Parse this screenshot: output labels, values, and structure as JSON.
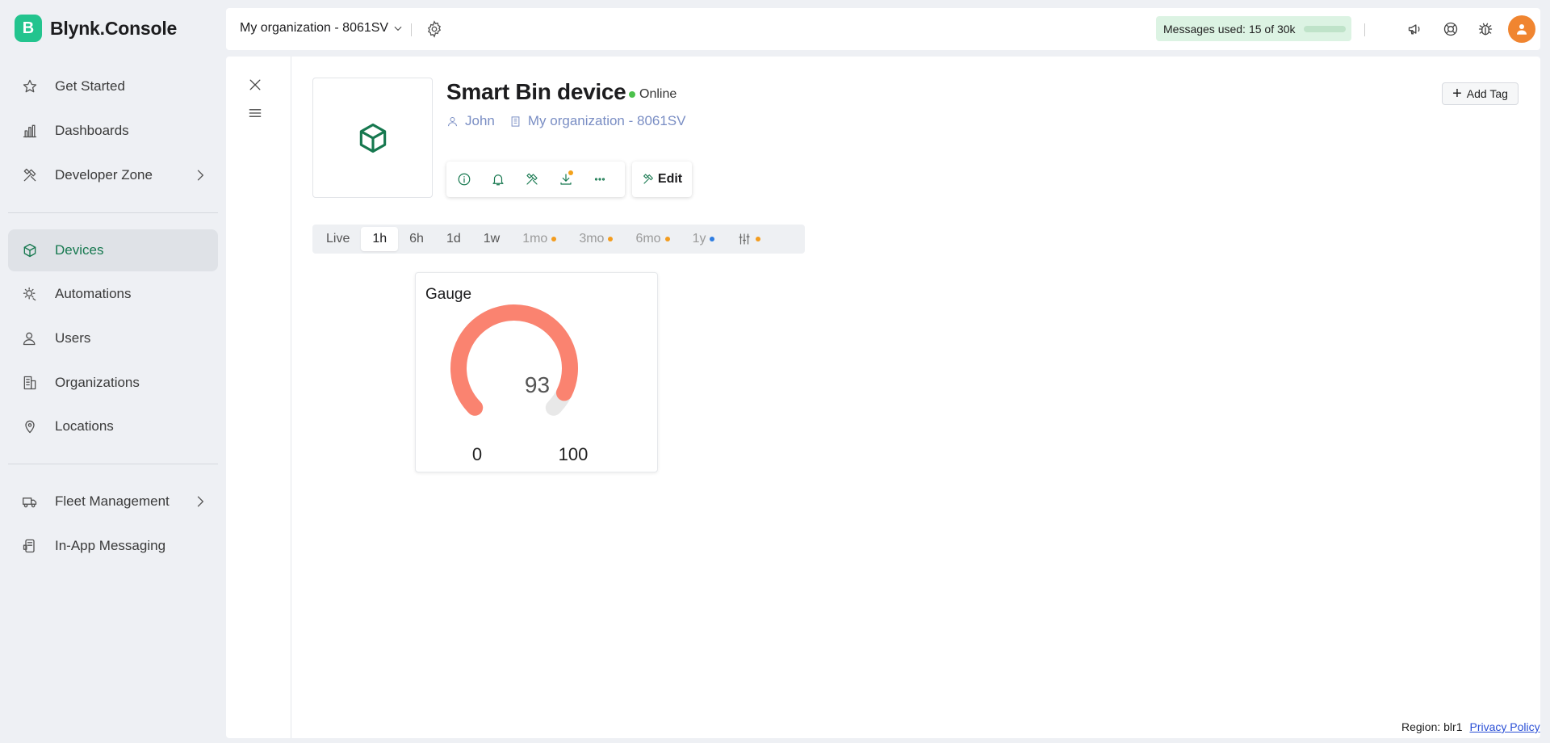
{
  "brand": {
    "badge": "B",
    "name": "Blynk.Console"
  },
  "sidebar": {
    "items": [
      {
        "label": "Get Started",
        "icon": "star-icon"
      },
      {
        "label": "Dashboards",
        "icon": "bar-chart-icon"
      },
      {
        "label": "Developer Zone",
        "icon": "tools-icon",
        "has_chevron": true
      },
      {
        "label": "Devices",
        "icon": "cube-icon",
        "active": true
      },
      {
        "label": "Automations",
        "icon": "automation-icon"
      },
      {
        "label": "Users",
        "icon": "user-icon"
      },
      {
        "label": "Organizations",
        "icon": "building-icon"
      },
      {
        "label": "Locations",
        "icon": "location-pin-icon"
      },
      {
        "label": "Fleet Management",
        "icon": "truck-icon",
        "has_chevron": true
      },
      {
        "label": "In-App Messaging",
        "icon": "message-icon"
      }
    ]
  },
  "header": {
    "org_select": "My organization - 8061SV",
    "messages_label": "Messages used:",
    "messages_value": "15 of 30k",
    "messages_fraction": 0.0005,
    "icons": [
      "megaphone-icon",
      "help-lifebuoy-icon",
      "bug-icon",
      "avatar"
    ]
  },
  "device": {
    "name": "Smart Bin device",
    "status": "Online",
    "owner": "John",
    "organization": "My organization - 8061SV",
    "actions": [
      "info-icon",
      "bell-icon",
      "tools-icon",
      "download-icon",
      "more-icon"
    ],
    "edit_label": "Edit",
    "add_tag_label": "Add Tag"
  },
  "time_ranges": [
    {
      "label": "Live"
    },
    {
      "label": "1h",
      "active": true
    },
    {
      "label": "6h"
    },
    {
      "label": "1d"
    },
    {
      "label": "1w"
    },
    {
      "label": "1mo",
      "locked": true,
      "dot_color": "#f39c1f"
    },
    {
      "label": "3mo",
      "locked": true,
      "dot_color": "#f39c1f"
    },
    {
      "label": "6mo",
      "locked": true,
      "dot_color": "#f39c1f"
    },
    {
      "label": "1y",
      "locked": true,
      "dot_color": "#2f7de1"
    },
    {
      "label": "",
      "icon": "sliders-icon",
      "dot_color": "#f39c1f"
    }
  ],
  "widget": {
    "title": "Gauge",
    "value": "93",
    "min": "0",
    "max": "100",
    "value_number": 93,
    "fill_color": "#fa8370",
    "track_color": "#e8e8e8"
  },
  "footer": {
    "region": "Region: blr1",
    "privacy": "Privacy Policy"
  },
  "colors": {
    "accent": "#16784f",
    "brand": "#23c48e",
    "online": "#4cc14c"
  }
}
